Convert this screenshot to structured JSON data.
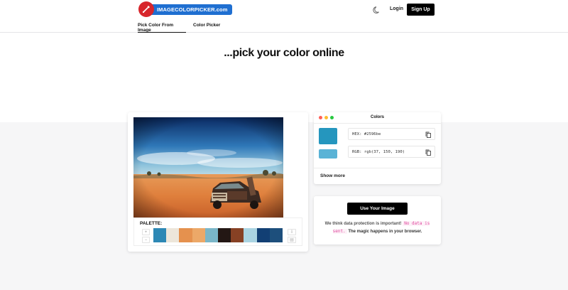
{
  "header": {
    "logo_text": "IMAGECOLORPICKER.com",
    "login_label": "Login",
    "signup_label": "Sign Up"
  },
  "tabs": [
    {
      "label": "Pick Color From Image",
      "active": true
    },
    {
      "label": "Color Picker",
      "active": false
    }
  ],
  "hero": {
    "title": "...pick your color online"
  },
  "image_panel": {
    "palette_label": "PALETTE:",
    "palette_colors": [
      "#2d88b5",
      "#ede6da",
      "#e5914e",
      "#eca868",
      "#7ab6c8",
      "#231714",
      "#874124",
      "#aad4e2",
      "#123f74",
      "#1d4f7c"
    ]
  },
  "colors_panel": {
    "title": "Colors",
    "window_dots": [
      "#ff5f57",
      "#febc2e",
      "#28c840"
    ],
    "selected_color": "#2596be",
    "hover_color": "#5ab3d6",
    "hex_text": "HEX: #2596be",
    "rgb_text": "RGB: rgb(37, 150, 190)",
    "show_more_label": "Show more"
  },
  "upload_panel": {
    "button_label": "Use Your Image",
    "note_prefix": "We think data protection is important!",
    "note_code": "No data is sent.",
    "note_suffix": "The magic happens in your browser."
  }
}
